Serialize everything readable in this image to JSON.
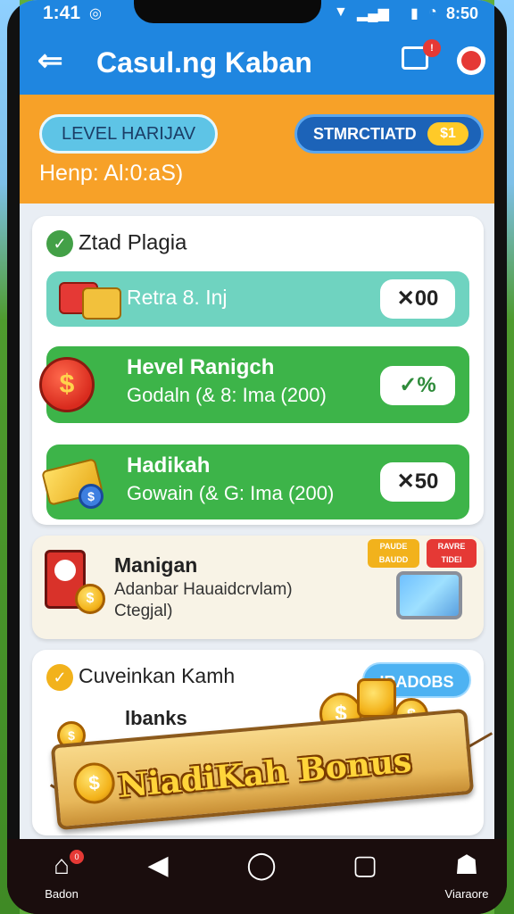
{
  "status_bar": {
    "time": "1:41",
    "right_time": "8:50",
    "signal_icon": "signal-icon",
    "wifi_icon": "wifi-icon",
    "battery_icon": "battery-icon"
  },
  "app_bar": {
    "title": "Casul.ng Kaban",
    "back_icon": "back-arrow-icon",
    "msg_badge": "!",
    "message_icon": "message-icon",
    "alert_icon": "record-icon"
  },
  "header": {
    "level_pill": "LEVEL HARIJAV",
    "status_pill": "STMRCTIATD",
    "status_coin": "$1",
    "subtitle": "Henp: Al:0:aS)"
  },
  "section1": {
    "title": "Ztad Plagia",
    "rows": [
      {
        "label": "Retra 8. Inj",
        "reward": "✕00",
        "color": "#6fd3c0"
      },
      {
        "title": "Hevel Ranigch",
        "sub": "Godaln (& 8: Ima (200)",
        "reward": "✓%",
        "color": "#3db449"
      },
      {
        "title": "Hadikah",
        "sub": "Gowain (& G: Ima (200)",
        "reward": "✕50",
        "color": "#3db449"
      }
    ]
  },
  "section2": {
    "title": "Manigan",
    "sub_line1": "Adanbar Hauaidcrvlam)",
    "sub_line2": "Ctegjal)",
    "tag1": "PAUDE BAUDD",
    "tag2": "RAVRE TIDEI"
  },
  "section3": {
    "title": "Cuveinkan Kamh",
    "button": "IRADOBS",
    "line": "lbanks"
  },
  "banner": {
    "text": "NiadiKah Bonus"
  },
  "bottom_nav": {
    "items": [
      {
        "label": "Badon",
        "icon": "home-icon",
        "glyph": "⌂",
        "badge": "0"
      },
      {
        "label": "",
        "icon": "back-triangle-icon",
        "glyph": "◀"
      },
      {
        "label": "",
        "icon": "home-circle-icon",
        "glyph": "◯"
      },
      {
        "label": "",
        "icon": "recents-square-icon",
        "glyph": "▢"
      },
      {
        "label": "Viaraore",
        "icon": "profile-icon",
        "glyph": "☗"
      }
    ]
  }
}
